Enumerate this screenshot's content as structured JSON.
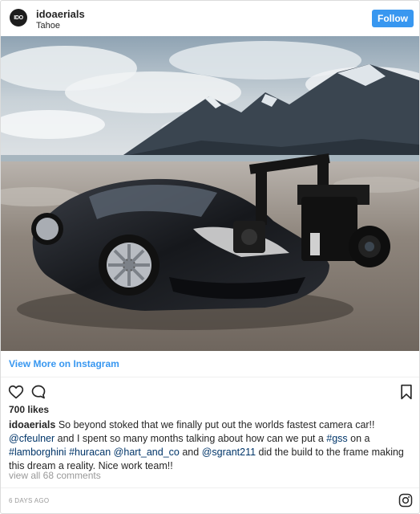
{
  "header": {
    "avatar_text": "IDO",
    "username": "idoaerials",
    "location": "Tahoe",
    "follow_label": "Follow"
  },
  "photo": {
    "alt": "Black Lamborghini Huracan camera car with camera crane arm on a beach with mountains",
    "colors": {
      "sky": "#b8c4cc",
      "mountain": "#2f3a45",
      "car": "#1a1c20",
      "sand": "#9a9088"
    }
  },
  "view_more": {
    "label": "View More on Instagram"
  },
  "actions": {
    "like_icon": "heart-icon",
    "comment_icon": "comment-icon",
    "save_icon": "bookmark-icon"
  },
  "likes": "700 likes",
  "caption": {
    "username": "idoaerials",
    "text_1": " So beyond stoked that we finally put out the worlds fastest camera car!! ",
    "mention_1": "@cfeulner",
    "text_2": " and I spent so many months talking about how can we put a ",
    "hashtag_1": "#gss",
    "text_3": " on a ",
    "hashtag_2": "#lamborghini",
    "text_4": " ",
    "hashtag_3": "#huracan",
    "text_5": " ",
    "mention_2": "@hart_and_co",
    "text_6": " and ",
    "mention_3": "@sgrant211",
    "text_7": " did the build to the frame making this dream a reality. Nice work team!!"
  },
  "comments_link": "view all 68 comments",
  "timestamp": "6 DAYS AGO",
  "footer": {
    "logo_icon": "instagram-logo-icon"
  }
}
